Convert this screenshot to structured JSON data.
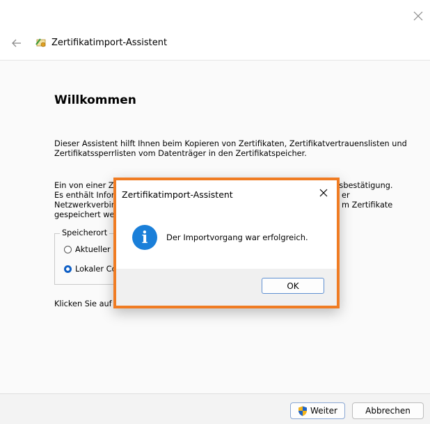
{
  "wizard": {
    "title": "Zertifikatimport-Assistent",
    "heading": "Willkommen",
    "paragraph1": "Dieser Assistent hilft Ihnen beim Kopieren von Zertifikaten, Zertifikatvertrauenslisten und Zertifikatssperrlisten vom Datenträger in den Zertifikatspeicher.",
    "paragraph2_visible": "Ein von einer Ze",
    "paragraph2_right": "tsbestätigung.",
    "paragraph2_line2_left": "Es enthält Infor",
    "paragraph2_line2_right": "er",
    "paragraph2_line3_left": "Netzwerkverbin",
    "paragraph2_line3_right": "m Zertifikate",
    "paragraph2_line4_left": "gespeichert wer",
    "storage_legend": "Speicherort",
    "radio_current_user": "Aktueller",
    "radio_local_machine": "Lokaler Co",
    "paragraph3": "Klicken Sie auf \"Weiter\", um den Vorgang fortzusetzen.",
    "next_label": "Weiter",
    "cancel_label": "Abbrechen"
  },
  "dialog": {
    "title": "Zertifikatimport-Assistent",
    "message": "Der Importvorgang war erfolgreich.",
    "ok_label": "OK",
    "icon": "info-icon"
  },
  "colors": {
    "highlight_border": "#f07c23",
    "info_blue": "#1a7fd9",
    "radio_selected": "#0f5fc5"
  }
}
